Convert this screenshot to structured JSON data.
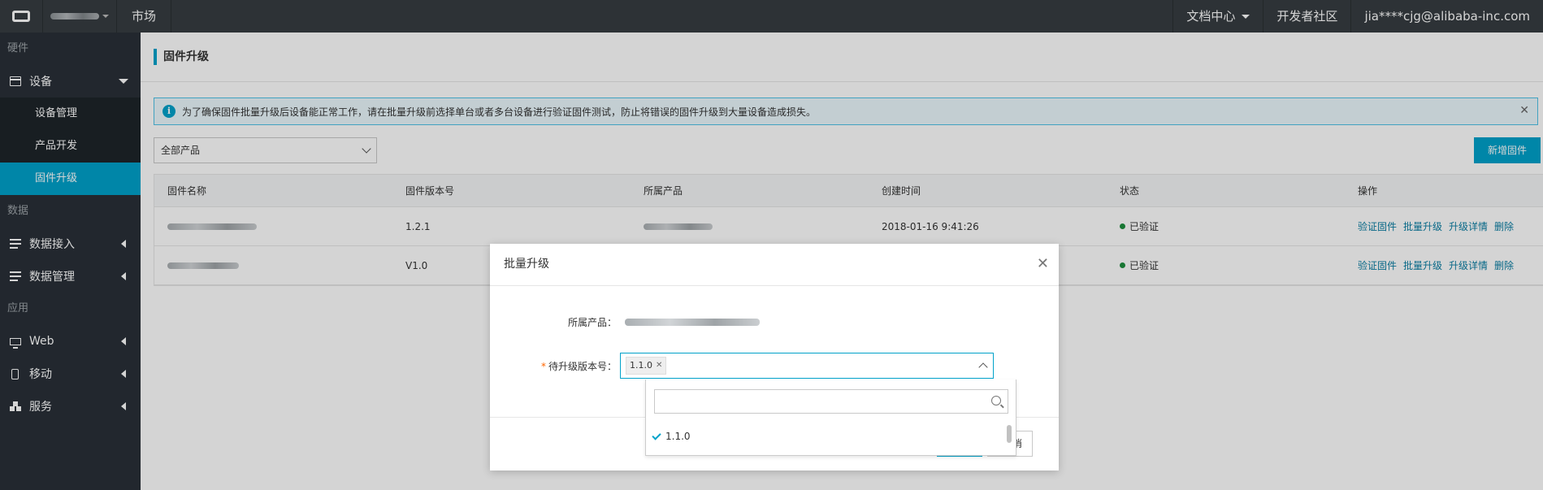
{
  "topbar": {
    "market_label": "市场",
    "docs_label": "文档中心",
    "community_label": "开发者社区",
    "user_email": "jia****cjg@alibaba-inc.com"
  },
  "sidebar": {
    "categories": [
      "硬件",
      "数据",
      "应用"
    ],
    "items": [
      {
        "label": "设备",
        "icon": "device-icon"
      },
      {
        "label": "数据接入",
        "icon": "database-icon"
      },
      {
        "label": "数据管理",
        "icon": "database-icon"
      },
      {
        "label": "Web",
        "icon": "monitor-icon"
      },
      {
        "label": "移动",
        "icon": "phone-icon"
      },
      {
        "label": "服务",
        "icon": "cubes-icon"
      }
    ],
    "subitems": [
      "设备管理",
      "产品开发",
      "固件升级"
    ],
    "active_subitem": "固件升级"
  },
  "main": {
    "page_title": "固件升级",
    "alert_text": "为了确保固件批量升级后设备能正常工作，请在批量升级前选择单台或者多台设备进行验证固件测试，防止将错误的固件升级到大量设备造成损失。",
    "product_filter": "全部产品",
    "add_button": "新增固件",
    "table": {
      "headers": [
        "固件名称",
        "固件版本号",
        "所属产品",
        "创建时间",
        "状态",
        "操作"
      ],
      "rows": [
        {
          "version": "1.2.1",
          "created": "2018-01-16 9:41:26",
          "status": "已验证"
        },
        {
          "version": "V1.0",
          "created": "",
          "status": "已验证"
        }
      ],
      "actions": [
        "验证固件",
        "批量升级",
        "升级详情",
        "删除"
      ]
    }
  },
  "dialog": {
    "title": "批量升级",
    "product_label": "所属产品：",
    "version_label": "待升级版本号：",
    "selected_tag": "1.1.0",
    "cancel_visible": "消",
    "dropdown_option": "1.1.0"
  },
  "colors": {
    "accent": "#00a2ca",
    "topbar": "#373d41",
    "sidebar": "#293038",
    "status_ok": "#1e8e3e"
  }
}
